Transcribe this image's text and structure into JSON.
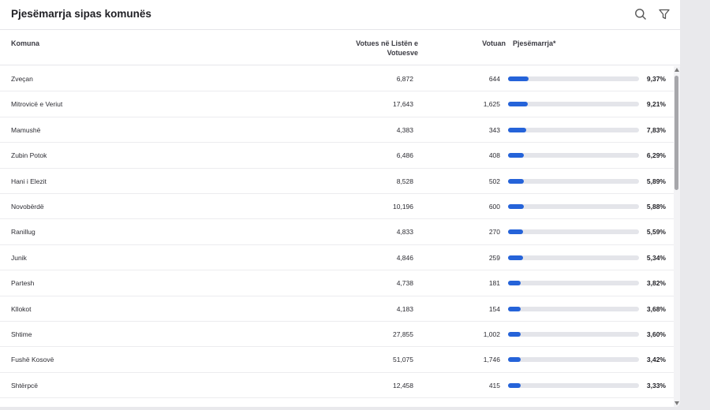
{
  "header": {
    "title": "Pjesëmarrja sipas komunës",
    "icons": {
      "search": "search-icon",
      "filter": "filter-icon"
    }
  },
  "table": {
    "columns": {
      "komuna": "Komuna",
      "registered_line1": "Votues në Listën e",
      "registered_line2": "Votuesve",
      "voted": "Votuan",
      "turnout": "Pjesëmarrja*"
    },
    "rows": [
      {
        "name": "Zveçan",
        "registered": "6,872",
        "voted": "644",
        "turnout": "9,37%",
        "turnout_value": 9.37
      },
      {
        "name": "Mitrovicë e Veriut",
        "registered": "17,643",
        "voted": "1,625",
        "turnout": "9,21%",
        "turnout_value": 9.21
      },
      {
        "name": "Mamushë",
        "registered": "4,383",
        "voted": "343",
        "turnout": "7,83%",
        "turnout_value": 7.83
      },
      {
        "name": "Zubin Potok",
        "registered": "6,486",
        "voted": "408",
        "turnout": "6,29%",
        "turnout_value": 6.29
      },
      {
        "name": "Hani i Elezit",
        "registered": "8,528",
        "voted": "502",
        "turnout": "5,89%",
        "turnout_value": 5.89
      },
      {
        "name": "Novobërdë",
        "registered": "10,196",
        "voted": "600",
        "turnout": "5,88%",
        "turnout_value": 5.88
      },
      {
        "name": "Ranillug",
        "registered": "4,833",
        "voted": "270",
        "turnout": "5,59%",
        "turnout_value": 5.59
      },
      {
        "name": "Junik",
        "registered": "4,846",
        "voted": "259",
        "turnout": "5,34%",
        "turnout_value": 5.34
      },
      {
        "name": "Partesh",
        "registered": "4,738",
        "voted": "181",
        "turnout": "3,82%",
        "turnout_value": 3.82
      },
      {
        "name": "Kllokot",
        "registered": "4,183",
        "voted": "154",
        "turnout": "3,68%",
        "turnout_value": 3.68
      },
      {
        "name": "Shtime",
        "registered": "27,855",
        "voted": "1,002",
        "turnout": "3,60%",
        "turnout_value": 3.6
      },
      {
        "name": "Fushë Kosovë",
        "registered": "51,075",
        "voted": "1,746",
        "turnout": "3,42%",
        "turnout_value": 3.42
      },
      {
        "name": "Shtërpcë",
        "registered": "12,458",
        "voted": "415",
        "turnout": "3,33%",
        "turnout_value": 3.33
      }
    ]
  },
  "colors": {
    "bar_fill": "#2563d9",
    "bar_track": "#e4e5ea"
  }
}
